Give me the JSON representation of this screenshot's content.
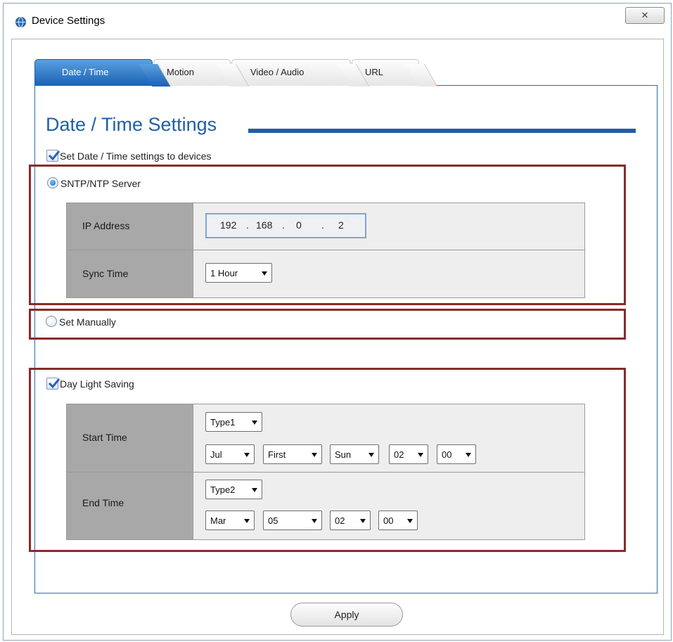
{
  "window": {
    "title": "Device Settings",
    "close_glyph": "✕"
  },
  "tabs": [
    {
      "label": "Date / Time",
      "active": true
    },
    {
      "label": "Motion",
      "active": false
    },
    {
      "label": "Video / Audio",
      "active": false
    },
    {
      "label": "URL",
      "active": false
    }
  ],
  "page_title": "Date / Time Settings",
  "set_to_devices": {
    "label": "Set Date / Time settings to devices",
    "checked": true
  },
  "sntp": {
    "label": "SNTP/NTP Server",
    "selected": true,
    "ip_label": "IP Address",
    "ip": [
      "192",
      "168",
      "0",
      "2"
    ],
    "sync_label": "Sync Time",
    "sync_value": "1 Hour"
  },
  "manual": {
    "label": "Set Manually",
    "selected": false
  },
  "dst": {
    "label": "Day Light Saving",
    "checked": true,
    "start_label": "Start Time",
    "start_type": "Type1",
    "start": {
      "month": "Jul",
      "week": "First",
      "day": "Sun",
      "hour": "02",
      "minute": "00"
    },
    "end_label": "End Time",
    "end_type": "Type2",
    "end": {
      "month": "Mar",
      "date": "05",
      "hour": "02",
      "minute": "00"
    }
  },
  "apply_label": "Apply",
  "colors": {
    "accent": "#1f5fa8",
    "highlight": "#8b2a2a",
    "tab_active": "#1a62b4"
  },
  "icons": [
    "app-globe-icon",
    "close-icon",
    "checkmark-icon",
    "radio-dot-icon",
    "dropdown-arrow-icon"
  ]
}
